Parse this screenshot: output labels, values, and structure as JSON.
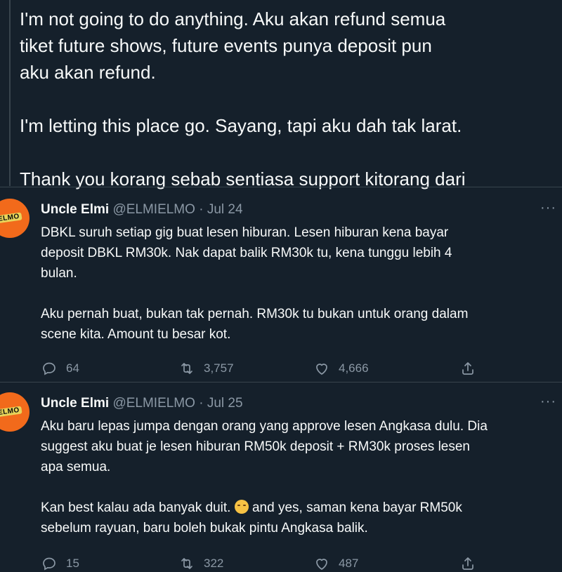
{
  "top_tweet": {
    "lines": [
      "I'm not going to do anything. Aku akan refund semua",
      "tiket future shows, future events punya deposit pun",
      "aku akan refund.",
      "I'm letting this place go. Sayang, tapi aku dah tak larat.",
      "Thank you korang sebab sentiasa support kitorang dari"
    ]
  },
  "tweets": [
    {
      "name": "Uncle Elmi",
      "handle": "@ELMIELMO",
      "dot": "·",
      "date": "Jul 24",
      "avatar_text": "ELMO",
      "more": "···",
      "paragraph1": [
        "DBKL suruh setiap gig buat lesen hiburan. Lesen hiburan kena bayar",
        "deposit DBKL RM30k. Nak dapat balik RM30k tu, kena tunggu lebih 4",
        "bulan."
      ],
      "paragraph2": [
        "Aku pernah buat, bukan tak pernah. RM30k tu bukan untuk orang dalam",
        "scene kita. Amount tu besar kot."
      ],
      "replies": "64",
      "retweets": "3,757",
      "likes": "4,666"
    },
    {
      "name": "Uncle Elmi",
      "handle": "@ELMIELMO",
      "dot": "·",
      "date": "Jul 25",
      "avatar_text": "ELMO",
      "more": "···",
      "paragraph1": [
        "Aku baru lepas jumpa dengan orang yang approve lesen Angkasa dulu. Dia",
        "suggest aku buat je lesen hiburan RM50k deposit + RM30k proses lesen",
        "apa semua."
      ],
      "paragraph2_line1_before": "Kan best kalau ada banyak duit.",
      "paragraph2_line1_after": " and yes, saman kena bayar RM50k",
      "paragraph2_line2": "sebelum rayuan, baru boleh bukak pintu Angkasa balik.",
      "replies": "15",
      "retweets": "322",
      "likes": "487"
    }
  ],
  "colors": {
    "background": "#15202b",
    "text": "#f7f9f9",
    "secondary": "#8b98a5",
    "divider": "#38444d",
    "avatar": "#f26a1b"
  },
  "icons": [
    "reply-icon",
    "retweet-icon",
    "like-icon",
    "share-icon",
    "more-icon"
  ]
}
